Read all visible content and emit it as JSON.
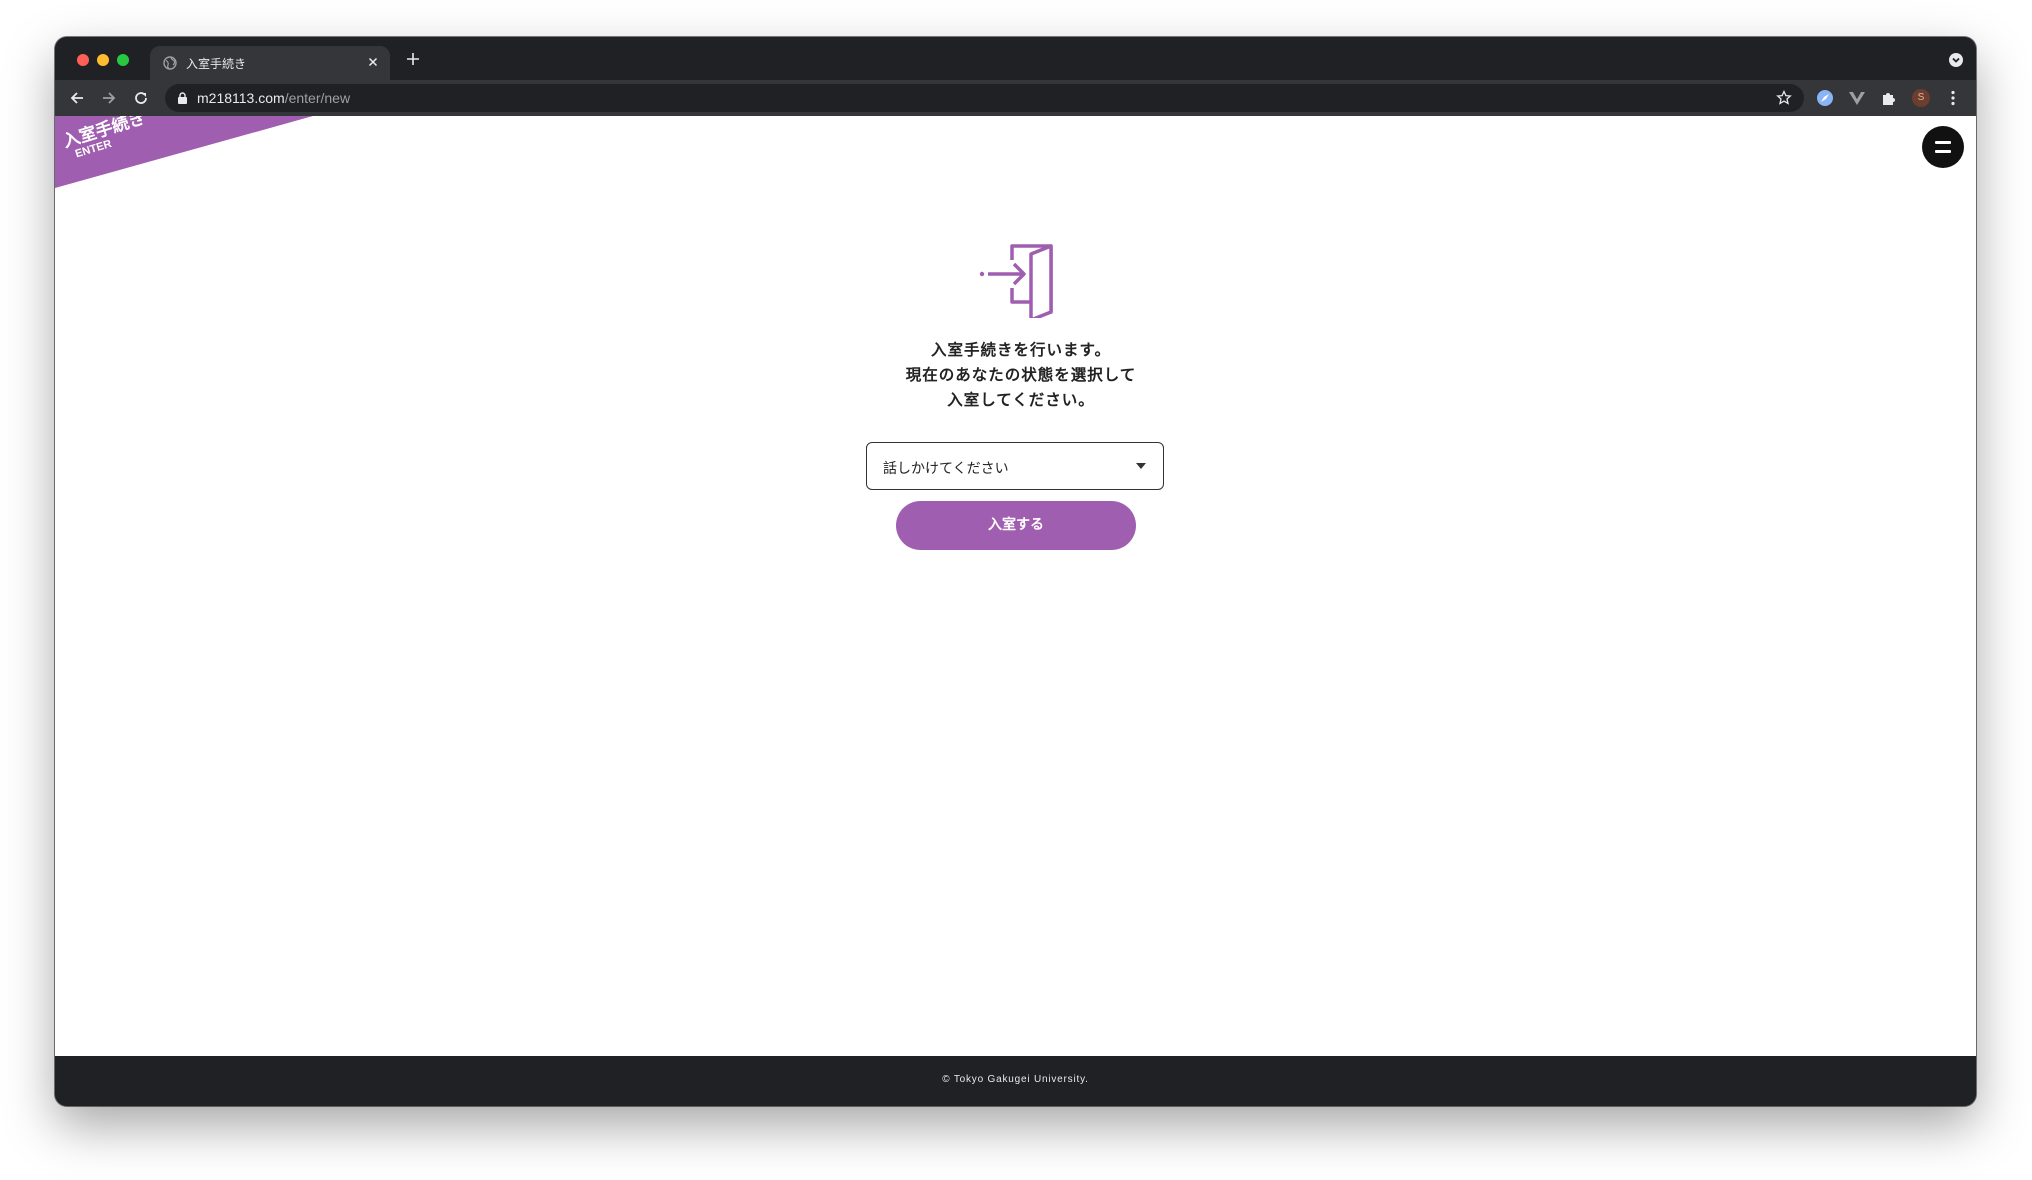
{
  "browser": {
    "tab": {
      "title": "入室手続き",
      "favicon": "globe-icon"
    },
    "address_bar": {
      "host": "m218113.com",
      "path": "/enter/new"
    },
    "profile_initial": "S"
  },
  "page": {
    "ribbon": {
      "title": "入室手続き",
      "subtitle": "ENTER",
      "color": "#a05eb0"
    },
    "instruction": {
      "line1": "入室手続きを行います。",
      "line2": "現在のあなたの状態を選択して",
      "line3": "入室してください。"
    },
    "status_select": {
      "value": "話しかけてください"
    },
    "enter_button": {
      "label": "入室する"
    },
    "footer": {
      "copyright": "© Tokyo Gakugei University."
    }
  },
  "colors": {
    "accent": "#a05eb0",
    "footer_bg": "#202124"
  }
}
